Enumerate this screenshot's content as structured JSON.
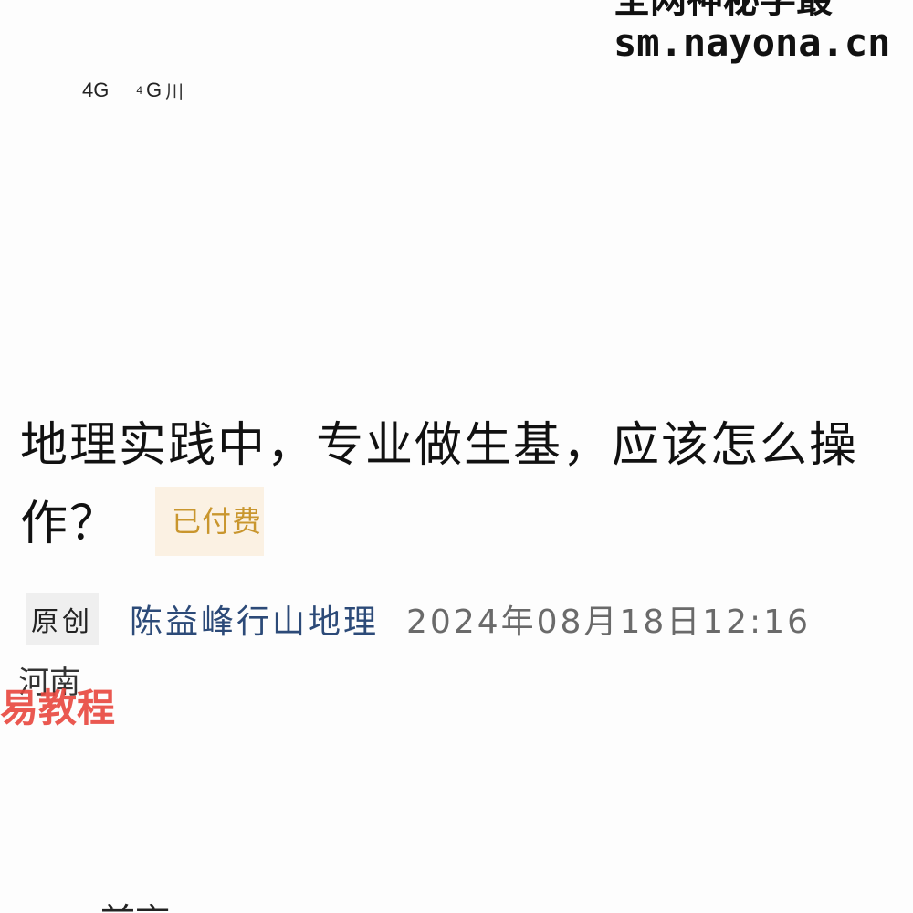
{
  "watermark": {
    "line1": "全网神秘学最",
    "line2": "sm.nayona.cn"
  },
  "status_bar": {
    "network_1": "4G",
    "network_2": "4G",
    "signal": "川"
  },
  "article": {
    "title": "地理实践中，专业做生基，应该怎么操作？",
    "paid_label": "已付费",
    "original_tag": "原创",
    "author": "陈益峰行山地理",
    "date": "2024年08月18日12:16",
    "location": "河南",
    "body_start": "前言"
  },
  "overlay_watermark": "易教程",
  "colors": {
    "author": "#2c4a78",
    "paid_text": "#c9962e",
    "paid_bg": "#fbf1e3",
    "watermark_red": "#e8473e"
  }
}
